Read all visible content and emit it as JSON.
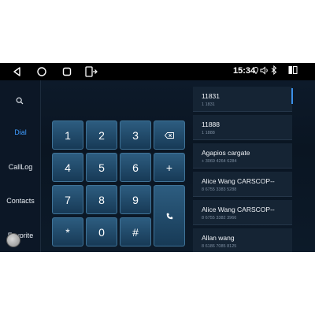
{
  "status": {
    "time": "15:34",
    "icons": [
      "back-icon",
      "home-icon",
      "recents-icon",
      "app-icon",
      "location-icon",
      "volume-icon",
      "bluetooth-icon",
      "dual-window-icon"
    ]
  },
  "sidebar": {
    "search_icon": "search-icon",
    "items": [
      {
        "label": "Dial",
        "active": true
      },
      {
        "label": "CallLog",
        "active": false
      },
      {
        "label": "Contacts",
        "active": false
      },
      {
        "label": "Favorite",
        "active": false
      }
    ]
  },
  "keypad": {
    "keys": [
      "1",
      "2",
      "3",
      "4",
      "5",
      "6",
      "7",
      "8",
      "9",
      "*",
      "0",
      "#"
    ],
    "backspace_icon": "backspace-icon",
    "plus": "+",
    "call_icon": "phone-icon"
  },
  "contacts": [
    {
      "name": "11831",
      "number": "1 1831"
    },
    {
      "name": "11888",
      "number": "1 1888"
    },
    {
      "name": "Agapios  cargate",
      "number": "+ 3069 4264 6284"
    },
    {
      "name": "Alice Wang   CARSCOP--",
      "number": "8 6755 3383 5288"
    },
    {
      "name": "Alice Wang   CARSCOP--",
      "number": "8 6755 3382 3966"
    },
    {
      "name": "Allan   wang",
      "number": "8 6186 7085 8125"
    }
  ],
  "colors": {
    "accent": "#3f9cff",
    "key_top": "#2d5d80",
    "key_bottom": "#173a56",
    "background": "#0a1522"
  }
}
